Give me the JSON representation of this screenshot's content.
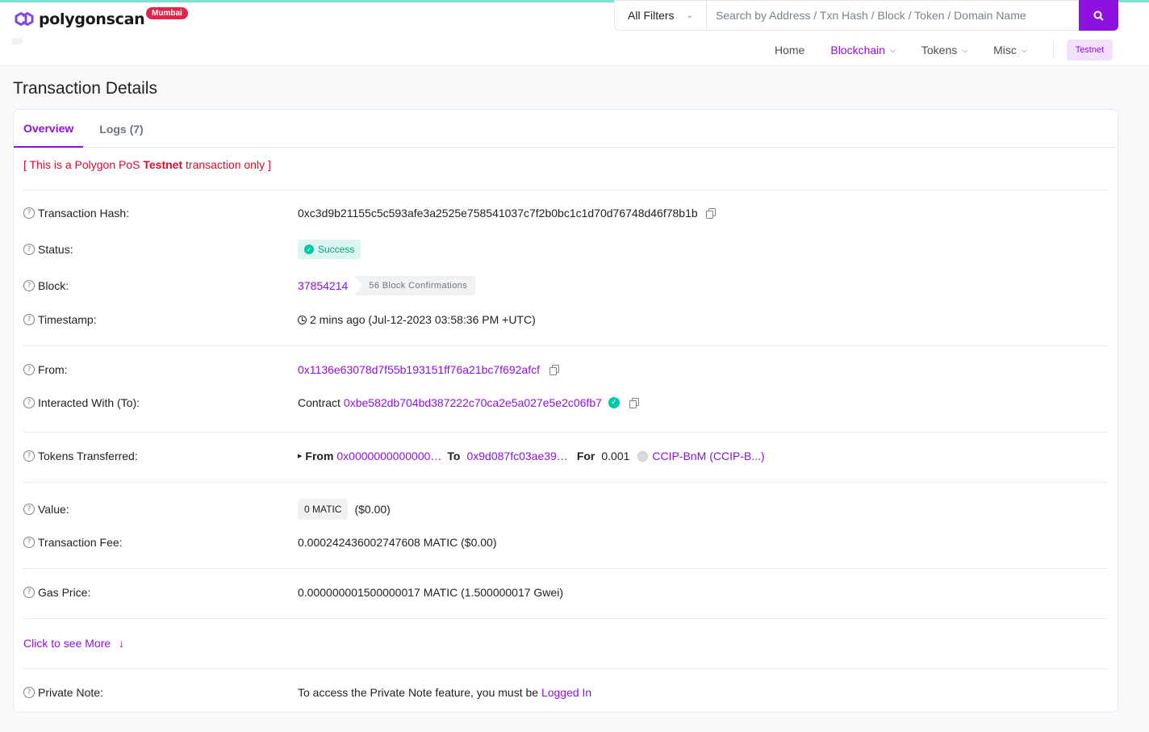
{
  "header": {
    "brand": "polygonscan",
    "network_badge": "Mumbai",
    "search": {
      "filter_label": "All Filters",
      "placeholder": "Search by Address / Txn Hash / Block / Token / Domain Name"
    },
    "nav": {
      "home": "Home",
      "blockchain": "Blockchain",
      "tokens": "Tokens",
      "misc": "Misc",
      "testnet": "Testnet"
    }
  },
  "page": {
    "title": "Transaction Details",
    "tabs": {
      "overview": "Overview",
      "logs": "Logs (7)"
    },
    "notice": {
      "prefix": "[ This is a Polygon PoS ",
      "bold": "Testnet",
      "suffix": " transaction only ]"
    }
  },
  "details": {
    "tx_hash": {
      "label": "Transaction Hash:",
      "value": "0xc3d9b21155c5c593afe3a2525e758541037c7f2b0bc1c1d70d76748d46f78b1b"
    },
    "status": {
      "label": "Status:",
      "value": "Success"
    },
    "block": {
      "label": "Block:",
      "value": "37854214",
      "confirmations": "56 Block Confirmations"
    },
    "timestamp": {
      "label": "Timestamp:",
      "value": "2 mins ago (Jul-12-2023 03:58:36 PM +UTC)"
    },
    "from": {
      "label": "From:",
      "value": "0x1136e63078d7f55b193151ff76a21bc7f692afcf"
    },
    "to": {
      "label": "Interacted With (To):",
      "prefix": "Contract",
      "value": "0xbe582db704bd387222c70ca2e5a027e5e2c06fb7"
    },
    "tokens": {
      "label": "Tokens Transferred:",
      "from_label": "From",
      "from_value": "0x0000000000000…",
      "to_label": "To",
      "to_value": "0x9d087fc03ae39…",
      "for_label": "For",
      "amount": "0.001",
      "token": "CCIP-BnM (CCIP-B...)"
    },
    "value": {
      "label": "Value:",
      "badge": "0 MATIC",
      "usd": "($0.00)"
    },
    "fee": {
      "label": "Transaction Fee:",
      "value": "0.000242436002747608 MATIC ($0.00)"
    },
    "gas": {
      "label": "Gas Price:",
      "value": "0.000000001500000017 MATIC (1.500000017 Gwei)"
    },
    "see_more": "Click to see More",
    "private_note": {
      "label": "Private Note:",
      "text": "To access the Private Note feature, you must be ",
      "link": "Logged In"
    }
  },
  "colors": {
    "accent": "#8f11e0",
    "danger": "#de0a2a",
    "success": "#00c9a7"
  }
}
